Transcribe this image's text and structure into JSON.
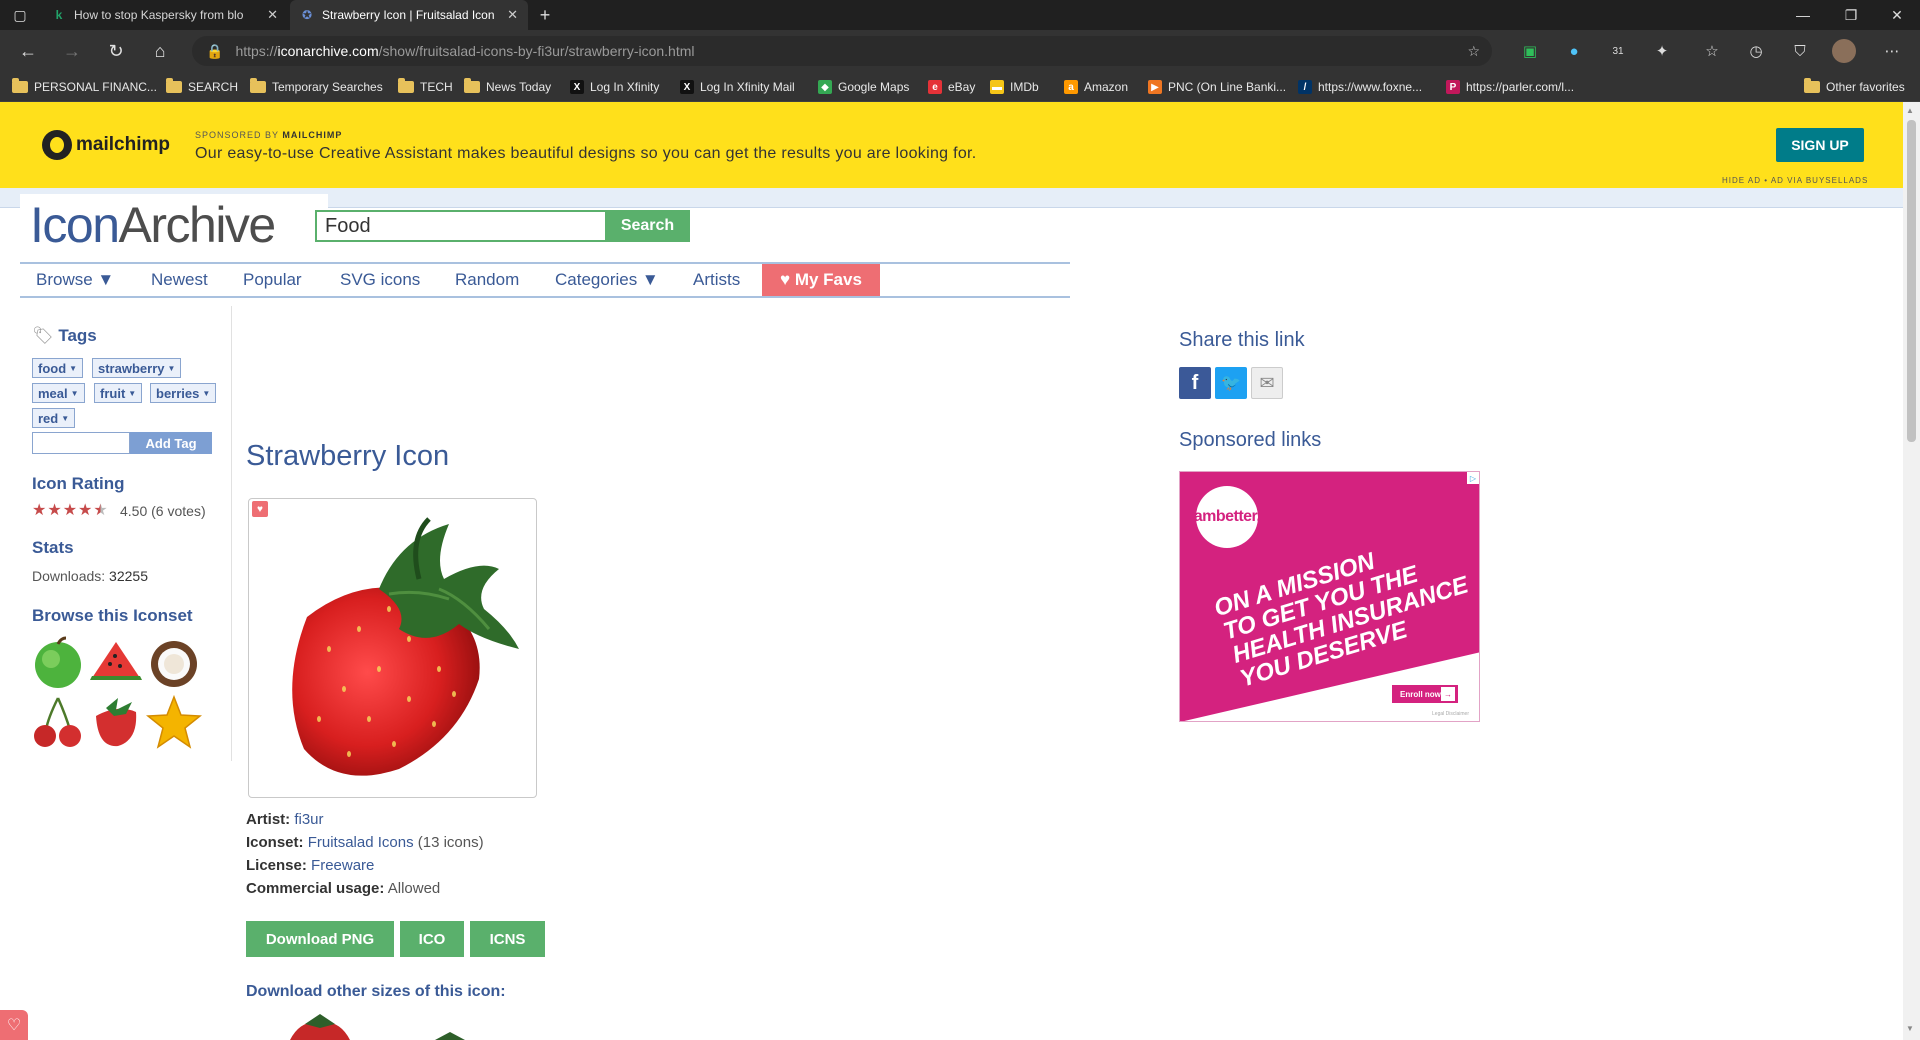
{
  "browser": {
    "tabs": [
      {
        "title": "How to stop Kaspersky from blo",
        "favicon": "kaspersky-icon",
        "active": false
      },
      {
        "title": "Strawberry Icon | Fruitsalad Icon",
        "favicon": "iconarchive-icon",
        "active": true
      }
    ],
    "new_tab_label": "+",
    "url_scheme": "https://",
    "url_host": "iconarchive.com",
    "url_path": "/show/fruitsalad-icons-by-fi3ur/strawberry-icon.html",
    "extension_badge": "31",
    "bookmarks": [
      {
        "label": "PERSONAL FINANC...",
        "icon": "folder-icon"
      },
      {
        "label": "SEARCH",
        "icon": "folder-icon"
      },
      {
        "label": "Temporary Searches",
        "icon": "folder-icon"
      },
      {
        "label": "TECH",
        "icon": "folder-icon"
      },
      {
        "label": "News Today",
        "icon": "folder-icon"
      },
      {
        "label": "Log In Xfinity",
        "icon": "xfinity-icon"
      },
      {
        "label": "Log In Xfinity Mail",
        "icon": "xfinity-icon"
      },
      {
        "label": "Google Maps",
        "icon": "maps-icon"
      },
      {
        "label": "eBay",
        "icon": "ebay-icon"
      },
      {
        "label": "IMDb",
        "icon": "imdb-icon"
      },
      {
        "label": "Amazon",
        "icon": "amazon-icon"
      },
      {
        "label": "PNC (On Line Banki...",
        "icon": "pnc-icon"
      },
      {
        "label": "https://www.foxne...",
        "icon": "foxnews-icon"
      },
      {
        "label": "https://parler.com/l...",
        "icon": "parler-icon"
      }
    ],
    "other_favorites": "Other favorites"
  },
  "ad_banner": {
    "brand": "mailchimp",
    "sponsored_prefix": "SPONSORED BY",
    "sponsored_brand": "MAILCHIMP",
    "text": "Our easy-to-use Creative Assistant makes beautiful designs so you can get the results you are looking for.",
    "cta": "SIGN UP",
    "hide_text": "HIDE AD • AD VIA BUYSELLADS"
  },
  "site": {
    "logo_icon": "Icon",
    "logo_archive": "Archive",
    "search_value": "Food",
    "search_button": "Search",
    "nav": [
      "Browse ▼",
      "Newest",
      "Popular",
      "SVG icons",
      "Random",
      "Categories ▼",
      "Artists",
      "♥ My Favs"
    ]
  },
  "sidebar": {
    "tags_heading": "Tags",
    "tags": [
      "food",
      "strawberry",
      "meal",
      "fruit",
      "berries",
      "red"
    ],
    "add_tag_button": "Add Tag",
    "rating_heading": "Icon Rating",
    "rating_value": 4.5,
    "rating_text": "4.50 (6 votes)",
    "stats_heading": "Stats",
    "downloads_label": "Downloads:",
    "downloads_value": "32255",
    "browse_heading": "Browse this Iconset",
    "iconset_thumbs": [
      "apple-icon",
      "watermelon-icon",
      "coconut-icon",
      "cherry-icon",
      "strawberry-icon",
      "starfruit-icon"
    ]
  },
  "main": {
    "title": "Strawberry Icon",
    "artist_label": "Artist:",
    "artist": "fi3ur",
    "iconset_label": "Iconset:",
    "iconset": "Fruitsalad Icons",
    "iconset_count": "(13 icons)",
    "license_label": "License:",
    "license": "Freeware",
    "commercial_label": "Commercial usage:",
    "commercial": "Allowed",
    "buttons": [
      "Download PNG",
      "ICO",
      "ICNS"
    ],
    "other_sizes": "Download other sizes of this icon:"
  },
  "right": {
    "share_heading": "Share this link",
    "sponsored_heading": "Sponsored links",
    "ambetter_brand": "ambetter.",
    "ambetter_headline": [
      "ON A MISSION",
      "TO GET YOU THE",
      "HEALTH INSURANCE",
      "YOU DESERVE"
    ],
    "ambetter_cta": "Enroll now",
    "ambetter_legal": "Legal Disclaimer"
  },
  "colors": {
    "brand_blue": "#3a5a96",
    "green": "#5ab06c",
    "favs_red": "#ee6e73",
    "banner_yellow": "#ffe01b",
    "ambetter_pink": "#d4227f"
  }
}
